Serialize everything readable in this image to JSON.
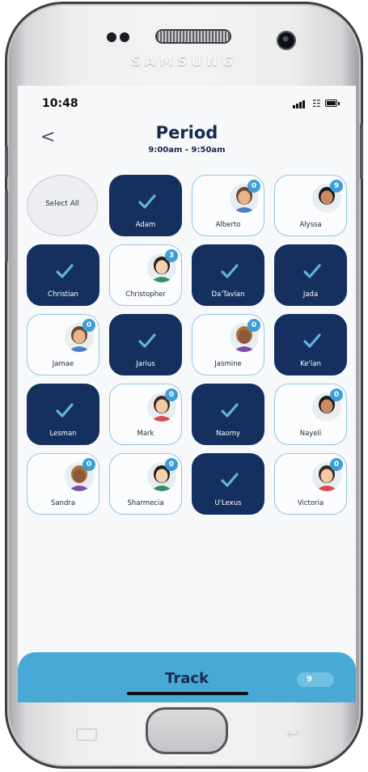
{
  "device": {
    "brand": "SAMSUNG"
  },
  "status_bar": {
    "time": "10:48"
  },
  "header": {
    "back_label": "<",
    "title": "Period",
    "subtitle": "9:00am - 9:50am"
  },
  "select_all": {
    "label": "Select All"
  },
  "students": [
    {
      "name": "Adam",
      "checked": true
    },
    {
      "name": "Alberto",
      "checked": false,
      "count": "0",
      "avatar": "student-avatar"
    },
    {
      "name": "Alyssa",
      "checked": false,
      "count": "9",
      "avatar": "student-avatar"
    },
    {
      "name": "Christian",
      "checked": true
    },
    {
      "name": "Christopher",
      "checked": false,
      "count": "3",
      "avatar": "student-avatar"
    },
    {
      "name": "Da'Tavian",
      "checked": true
    },
    {
      "name": "Jada",
      "checked": true
    },
    {
      "name": "Jamae",
      "checked": false,
      "count": "0",
      "avatar": "student-avatar"
    },
    {
      "name": "Jarius",
      "checked": true
    },
    {
      "name": "Jasmine",
      "checked": false,
      "count": "0",
      "avatar": "student-avatar"
    },
    {
      "name": "Ke'lan",
      "checked": true
    },
    {
      "name": "Lesman",
      "checked": true
    },
    {
      "name": "Mark",
      "checked": false,
      "count": "0",
      "avatar": "student-avatar"
    },
    {
      "name": "Naomy",
      "checked": true
    },
    {
      "name": "Nayeli",
      "checked": false,
      "count": "0",
      "avatar": "student-avatar"
    },
    {
      "name": "Sandra",
      "checked": false,
      "count": "0",
      "avatar": "student-avatar"
    },
    {
      "name": "Sharmecia",
      "checked": false,
      "count": "0",
      "avatar": "student-avatar"
    },
    {
      "name": "U'Lexus",
      "checked": true
    },
    {
      "name": "Victoria",
      "checked": false,
      "count": "0",
      "avatar": "student-avatar"
    }
  ],
  "track_bar": {
    "label": "Track",
    "count": "9"
  },
  "colors": {
    "checked_tile": "#15305f",
    "unchecked_border": "#8fc8e2",
    "badge": "#3c9ed7",
    "track_bar": "#48a9d6",
    "title": "#16294f"
  }
}
